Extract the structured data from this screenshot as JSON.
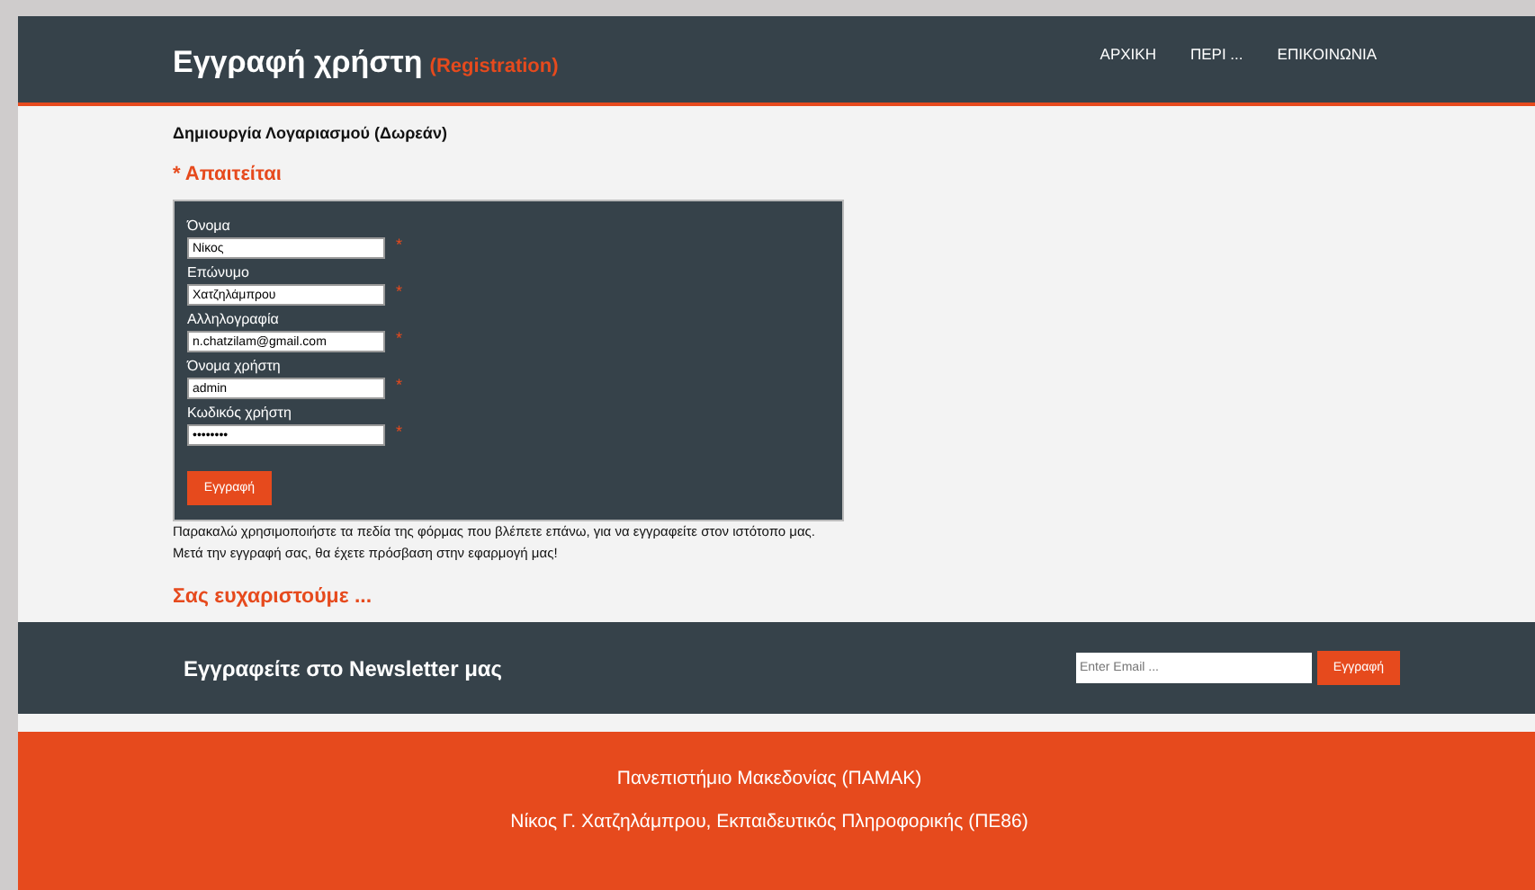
{
  "header": {
    "title": "Εγγραφή χρήστη",
    "subtitle": "(Registration)",
    "nav": [
      {
        "label": "ΑΡΧΙΚΗ"
      },
      {
        "label": "ΠΕΡΙ ..."
      },
      {
        "label": "ΕΠΙΚΟΙΝΩΝΙΑ"
      }
    ]
  },
  "heading": "Δημιουργία Λογαριασμού (Δωρεάν)",
  "required_note": "* Απαιτείται",
  "form": {
    "fields": [
      {
        "label": "Όνομα",
        "value": "Νίκος",
        "required_mark": "*"
      },
      {
        "label": "Επώνυμο",
        "value": "Χατζηλάμπρου",
        "required_mark": "*"
      },
      {
        "label": "Αλληλογραφία",
        "value": "n.chatzilam@gmail.com",
        "required_mark": "*"
      },
      {
        "label": "Όνομα χρήστη",
        "value": "admin",
        "required_mark": "*"
      },
      {
        "label": "Κωδικός χρήστη",
        "value": "••••••••",
        "required_mark": "*"
      }
    ],
    "submit": "Εγγραφή"
  },
  "info_lines": [
    "Παρακαλώ χρησιμοποιήστε τα πεδία της φόρμας που βλέπετε επάνω, για να εγγραφείτε στον ιστότοπο μας.",
    "Μετά την εγγραφή σας, θα έχετε πρόσβαση στην εφαρμογή μας!"
  ],
  "thanks": "Σας ευχαριστούμε ...",
  "newsletter": {
    "title": "Εγγραφείτε στο Newsletter μας",
    "placeholder": "Enter Email ...",
    "button": "Εγγραφή"
  },
  "footer": {
    "lines": [
      "Πανεπιστήμιο Μακεδονίας (ΠΑΜΑΚ)",
      "Νίκος Γ. Χατζηλάμπρου, Εκπαιδευτικός Πληροφορικής (ΠΕ86)"
    ]
  }
}
